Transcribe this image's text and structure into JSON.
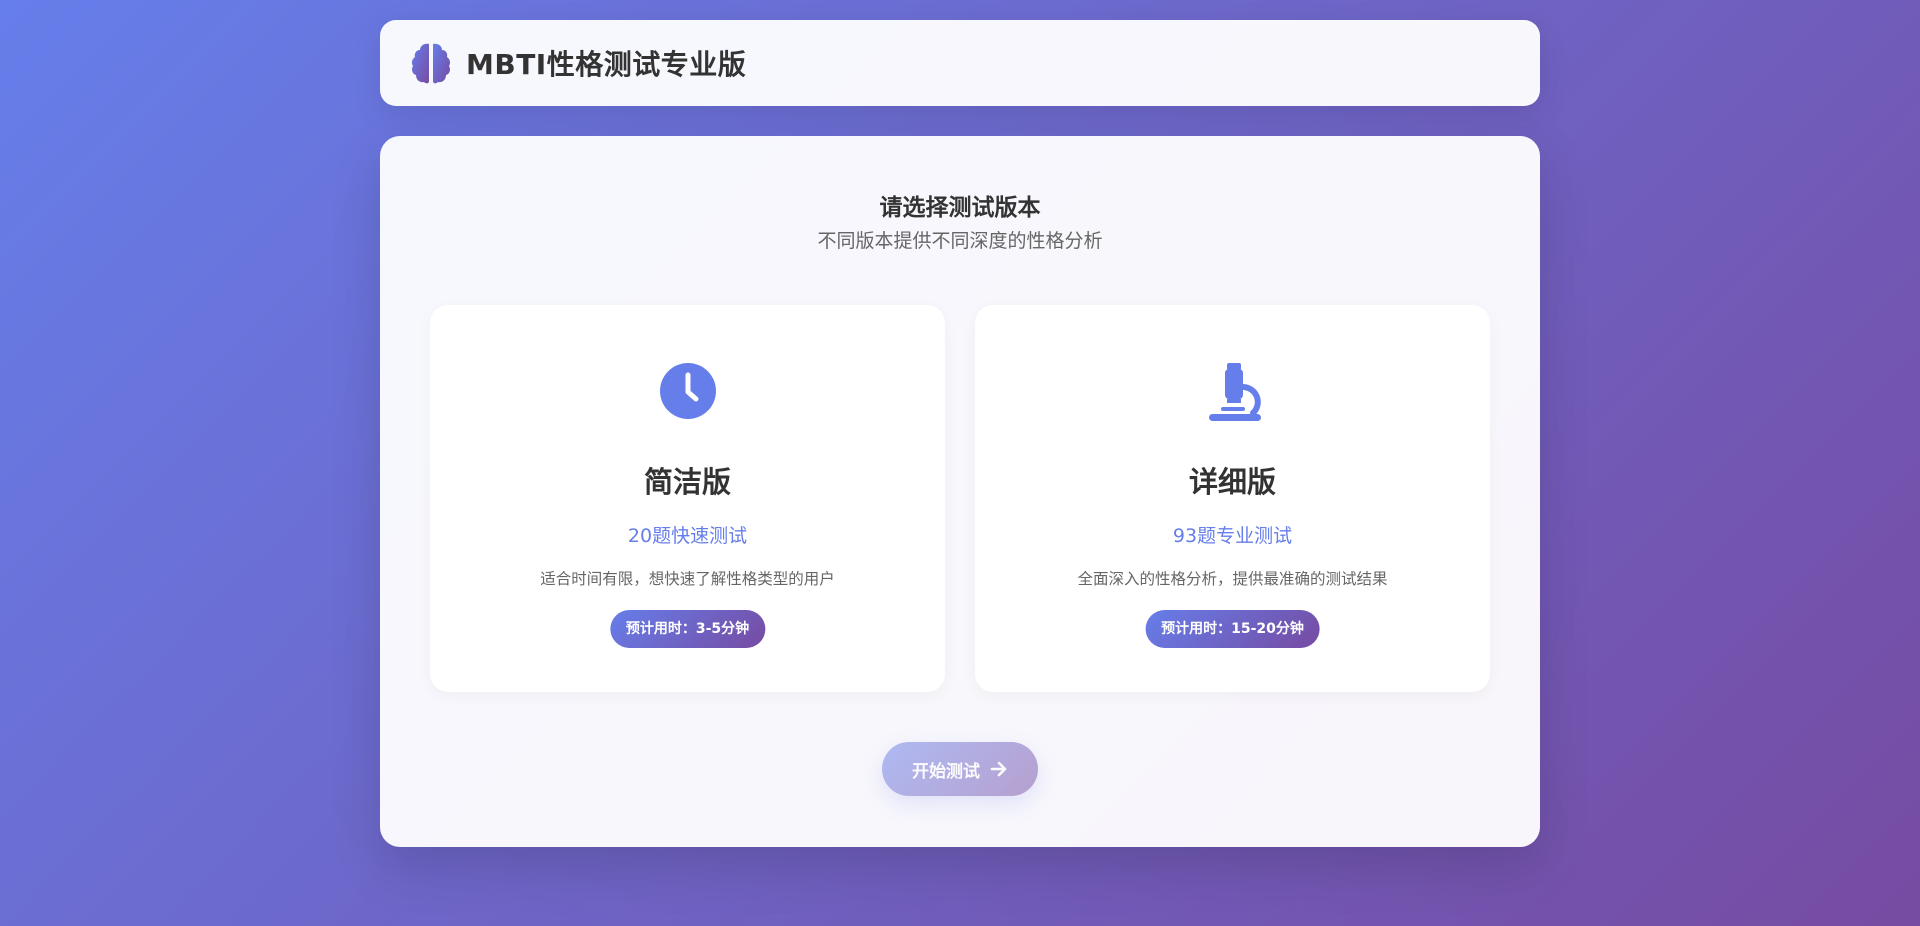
{
  "header": {
    "title": "MBTI性格测试专业版",
    "icon": "brain-icon"
  },
  "main": {
    "title": "请选择测试版本",
    "subtitle": "不同版本提供不同深度的性格分析",
    "versions": [
      {
        "icon": "clock-icon",
        "title": "简洁版",
        "count": "20题快速测试",
        "description": "适合时间有限，想快速了解性格类型的用户",
        "time": "预计用时：3-5分钟"
      },
      {
        "icon": "microscope-icon",
        "title": "详细版",
        "count": "93题专业测试",
        "description": "全面深入的性格分析，提供最准确的测试结果",
        "time": "预计用时：15-20分钟"
      }
    ],
    "start_button": {
      "label": "开始测试",
      "icon": "arrow-right-icon",
      "state": "disabled"
    }
  },
  "colors": {
    "gradient_start": "#667eea",
    "gradient_end": "#764ba2",
    "accent": "#667eea",
    "text": "#333333",
    "muted": "#666666"
  }
}
